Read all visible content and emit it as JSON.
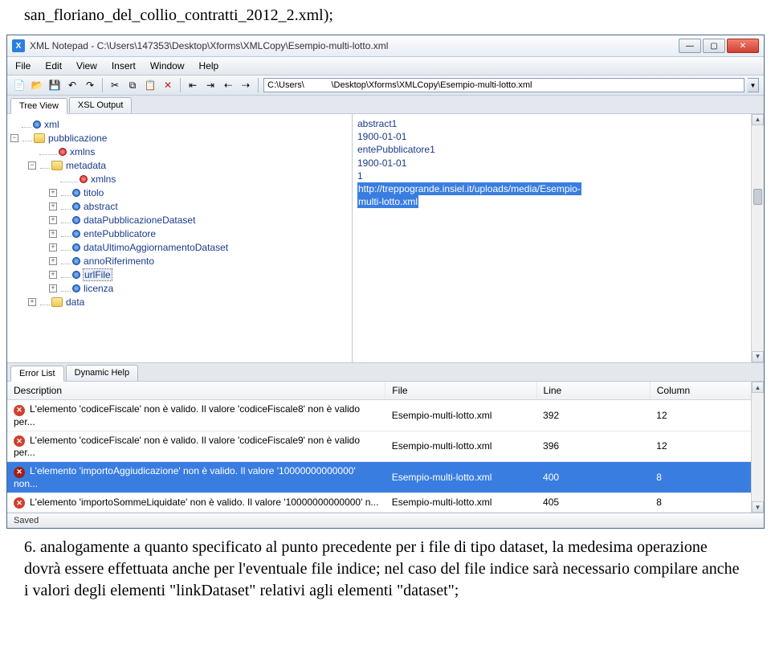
{
  "doc": {
    "line_top": "san_floriano_del_collio_contratti_2012_2.xml);",
    "para_bottom": "6. analogamente a quanto specificato al punto precedente per i file di tipo dataset, la medesima operazione dovrà essere effettuata anche per l'eventuale file indice; nel caso del file indice sarà necessario compilare anche i valori degli elementi \"linkDataset\" relativi agli elementi \"dataset\";"
  },
  "window": {
    "title": "XML Notepad - C:\\Users\\147353\\Desktop\\Xforms\\XMLCopy\\Esempio-multi-lotto.xml",
    "path": "C:\\Users\\           \\Desktop\\Xforms\\XMLCopy\\Esempio-multi-lotto.xml"
  },
  "menu": {
    "file": "File",
    "edit": "Edit",
    "view": "View",
    "insert": "Insert",
    "window": "Window",
    "help": "Help"
  },
  "tabs": {
    "tree": "Tree View",
    "xsl": "XSL Output"
  },
  "tree": {
    "n0": "xml",
    "n1": "pubblicazione",
    "n2": "xmlns",
    "n3": "metadata",
    "n4": "xmlns",
    "n5": "titolo",
    "n6": "abstract",
    "n7": "dataPubblicazioneDataset",
    "n8": "entePubblicatore",
    "n9": "dataUltimoAggiornamentoDataset",
    "n10": "annoRiferimento",
    "n11": "urlFile",
    "n12": "licenza",
    "n13": "data"
  },
  "values": {
    "v0": "abstract1",
    "v1": "1900-01-01",
    "v2": "entePubblicatore1",
    "v3": "1900-01-01",
    "v4": "1",
    "v5": "http://treppogrande.insiel.it/uploads/media/Esempio-",
    "v6": "multi-lotto.xml"
  },
  "bottom_tabs": {
    "errors": "Error List",
    "dynhelp": "Dynamic Help"
  },
  "errors": {
    "h_desc": "Description",
    "h_file": "File",
    "h_line": "Line",
    "h_col": "Column",
    "r1": {
      "desc": "L'elemento 'codiceFiscale' non è valido. Il valore 'codiceFiscale8' non è valido per...",
      "file": "Esempio-multi-lotto.xml",
      "line": "392",
      "col": "12"
    },
    "r2": {
      "desc": "L'elemento 'codiceFiscale' non è valido. Il valore 'codiceFiscale9' non è valido per...",
      "file": "Esempio-multi-lotto.xml",
      "line": "396",
      "col": "12"
    },
    "r3": {
      "desc": "L'elemento 'importoAggiudicazione' non è valido. Il valore '10000000000000' non...",
      "file": "Esempio-multi-lotto.xml",
      "line": "400",
      "col": "8"
    },
    "r4": {
      "desc": "L'elemento 'importoSommeLiquidate' non è valido. Il valore '10000000000000' n...",
      "file": "Esempio-multi-lotto.xml",
      "line": "405",
      "col": "8"
    }
  },
  "status": "Saved"
}
